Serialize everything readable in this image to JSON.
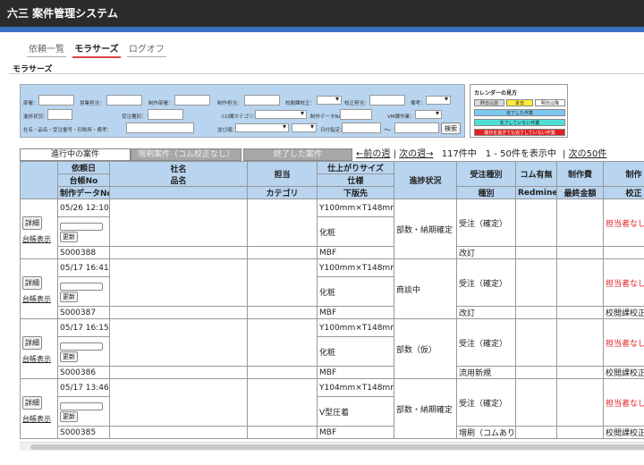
{
  "app": {
    "title": "六三 案件管理システム"
  },
  "nav": {
    "items": [
      "依頼一覧",
      "モラサーズ",
      "ログオフ"
    ],
    "active": "モラサーズ"
  },
  "page_label": "モラサーズ",
  "search": {
    "labels": {
      "busho": "部署：",
      "eigyo": "営業担当：",
      "seisaku_busho": "制作部署：",
      "seisaku_tanto": "制作担当：",
      "kouetsu": "校閲課校正：",
      "kousei_tanto": "校正担当：",
      "bikou": "備考：",
      "irai": "進捗状況：",
      "juchu": "受注種別：",
      "cd": "CD課カテゴリ：",
      "seisaku_data": "制作データNo：",
      "vm": "VM課作業：",
      "keyword": "社名・品名・受注番号・印刷所・備考：",
      "narabi": "並び順：",
      "hizuke": "日付指定：",
      "tilde": "～"
    },
    "search_button": "検索"
  },
  "legend": {
    "title": "カレンダーの見方",
    "items": [
      "昨日以前",
      "本日",
      "明日以降",
      "完了した作業",
      "完了していない作業",
      "期日を過ぎても完了していない作業"
    ],
    "colors": {
      "past": "#d9d9d9",
      "today": "#ffeb3b",
      "future": "#ffffff",
      "done": "#7ec8f0",
      "notdone": "#4ee0d8",
      "overdue": "#e02020"
    }
  },
  "tabs": {
    "in_progress": "進行中の案件",
    "extra": "増刷案件（コム校正なし）",
    "finished": "終了した案件"
  },
  "pager": {
    "prev": "←前の週",
    "sep": "|",
    "next": "次の週→",
    "count": "117件中　1 - 50件を表示中",
    "sep2": "|",
    "next50": "次の50件"
  },
  "table": {
    "headers": {
      "irai_date": "依頼日",
      "daicho_no": "台帳No",
      "seisaku_data_no": "制作データNo",
      "shamei": "社名",
      "hinmei": "品名",
      "tanto": "担当",
      "category": "カテゴリ",
      "size": "仕上がりサイズ",
      "shiyo": "仕様",
      "kahansaki": "下版先",
      "shinchoku": "進捗状況",
      "juchu": "受注種別",
      "shubetsu": "種別",
      "com": "コム有無",
      "redmine": "Redmine",
      "seisakuhi": "制作費",
      "saishu": "最終金額",
      "seisaku": "制作",
      "kousei": "校正"
    },
    "buttons": {
      "detail": "詳細",
      "daicho": "台帳表示",
      "update": "更新"
    },
    "rows": [
      {
        "date": "05/26 12:10",
        "size": "Y100mm×T148mm",
        "shiyo": "化粧",
        "kahansaki": "MBF",
        "status": "部数・納期確定",
        "juchu": "受注（確定）",
        "shubetsu": "改訂",
        "data_no": "S000388",
        "tanto_status": "担当者なし",
        "kousei": ""
      },
      {
        "date": "05/17 16:41",
        "size": "Y100mm×T148mm",
        "shiyo": "化粧",
        "kahansaki": "MBF",
        "status": "商談中",
        "juchu": "受注（確定）",
        "shubetsu": "改訂",
        "data_no": "S000387",
        "tanto_status": "担当者なし",
        "kousei": "校閲課校正不"
      },
      {
        "date": "05/17 16:15",
        "size": "Y100mm×T148mm",
        "shiyo": "化粧",
        "kahansaki": "MBF",
        "status": "部数（仮）",
        "juchu": "受注（確定）",
        "shubetsu": "流用新規",
        "data_no": "S000386",
        "tanto_status": "担当者なし",
        "kousei": "校閲課校正不"
      },
      {
        "date": "05/17 13:46",
        "size": "Y104mm×T148mm",
        "shiyo": "V型圧着",
        "kahansaki": "MBF",
        "status": "部数・納期確定",
        "juchu": "受注（確定）",
        "shubetsu": "増刷（コムあり）",
        "data_no": "S000385",
        "tanto_status": "担当者なし",
        "kousei": "校閲課校正不"
      }
    ]
  }
}
